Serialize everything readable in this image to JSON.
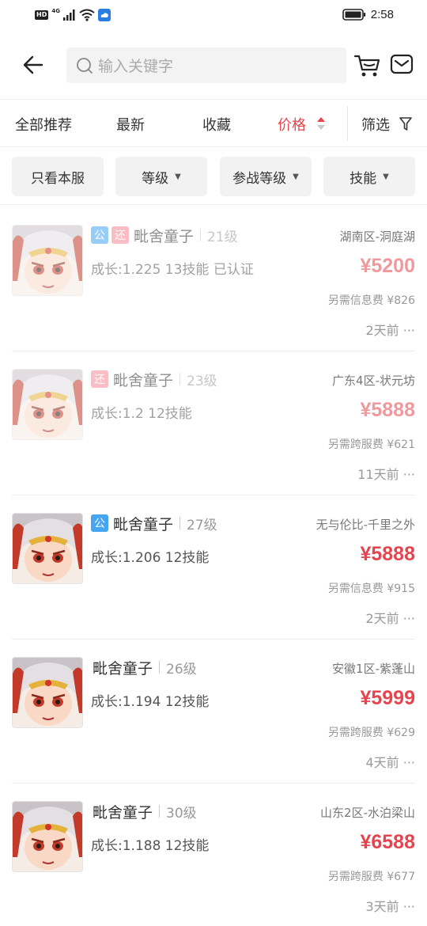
{
  "status_bar": {
    "hd": "HD",
    "network": "4G",
    "time": "2:58"
  },
  "header": {
    "search_placeholder": "输入关键字"
  },
  "sort_tabs": [
    "全部推荐",
    "最新",
    "收藏",
    "价格",
    "筛选"
  ],
  "filters": [
    "只看本服",
    "等级",
    "参战等级",
    "技能"
  ],
  "filter_caret": "▼",
  "listings": [
    {
      "badges": [
        "公",
        "还"
      ],
      "name": "毗舍童子",
      "level": "21级",
      "desc": "成长:1.225 13技能 已认证",
      "server": "湖南区-洞庭湖",
      "price": "¥5200",
      "fee": "另需信息费 ¥826",
      "time": "2天前 ···",
      "faded": true
    },
    {
      "badges": [
        "还"
      ],
      "name": "毗舍童子",
      "level": "23级",
      "desc": "成长:1.2 12技能",
      "server": "广东4区-状元坊",
      "price": "¥5888",
      "fee": "另需跨服费 ¥621",
      "time": "11天前 ···",
      "faded": true
    },
    {
      "badges": [
        "公"
      ],
      "name": "毗舍童子",
      "level": "27级",
      "desc": "成长:1.206 12技能",
      "server": "无与伦比-千里之外",
      "price": "¥5888",
      "fee": "另需信息费 ¥915",
      "time": "2天前 ···",
      "faded": false
    },
    {
      "badges": [],
      "name": "毗舍童子",
      "level": "26级",
      "desc": "成长:1.194 12技能",
      "server": "安徽1区-紫蓬山",
      "price": "¥5999",
      "fee": "另需跨服费 ¥629",
      "time": "4天前 ···",
      "faded": false
    },
    {
      "badges": [],
      "name": "毗舍童子",
      "level": "30级",
      "desc": "成长:1.188 12技能",
      "server": "山东2区-水泊梁山",
      "price": "¥6588",
      "fee": "另需跨服费 ¥677",
      "time": "3天前 ···",
      "faded": false
    }
  ],
  "colors": {
    "accent": "#e6444e",
    "badge_gong": "#45a5f0",
    "badge_huan": "#f58a96"
  }
}
